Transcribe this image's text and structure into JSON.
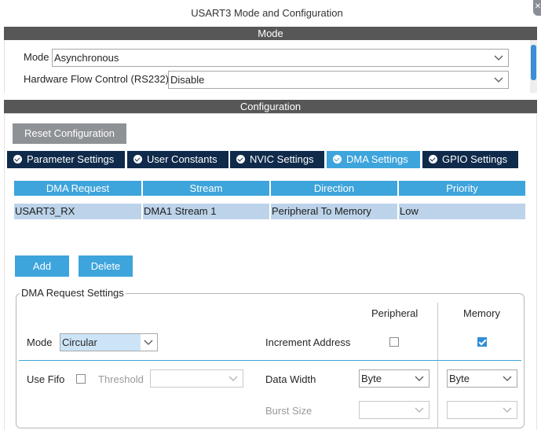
{
  "window": {
    "title": "USART3 Mode and Configuration"
  },
  "mode_section": {
    "header": "Mode",
    "mode_label": "Mode",
    "mode_value": "Asynchronous",
    "flow_label": "Hardware Flow Control (RS232)",
    "flow_value": "Disable"
  },
  "config_section": {
    "header": "Configuration",
    "reset_button": "Reset Configuration",
    "tabs": [
      {
        "label": "Parameter Settings",
        "active": false
      },
      {
        "label": "User Constants",
        "active": false
      },
      {
        "label": "NVIC Settings",
        "active": false
      },
      {
        "label": "DMA Settings",
        "active": true
      },
      {
        "label": "GPIO Settings",
        "active": false
      }
    ]
  },
  "dma_table": {
    "columns": [
      "DMA Request",
      "Stream",
      "Direction",
      "Priority"
    ],
    "rows": [
      [
        "USART3_RX",
        "DMA1 Stream 1",
        "Peripheral To Memory",
        "Low"
      ]
    ]
  },
  "buttons": {
    "add": "Add",
    "delete": "Delete"
  },
  "request_settings": {
    "legend": "DMA Request Settings",
    "peripheral_header": "Peripheral",
    "memory_header": "Memory",
    "mode_label": "Mode",
    "mode_value": "Circular",
    "increment_label": "Increment Address",
    "peripheral_increment": false,
    "memory_increment": true,
    "use_fifo_label": "Use Fifo",
    "use_fifo": false,
    "threshold_label": "Threshold",
    "threshold_value": "",
    "data_width_label": "Data Width",
    "peripheral_data_width": "Byte",
    "memory_data_width": "Byte",
    "burst_size_label": "Burst Size",
    "peripheral_burst_size": "",
    "memory_burst_size": ""
  },
  "colors": {
    "header_gray": "#575757",
    "tab_navy": "#0f2a4a",
    "accent_blue": "#3ea4dc",
    "row_selected": "#bcd3ea",
    "button_gray": "#8e9296"
  }
}
